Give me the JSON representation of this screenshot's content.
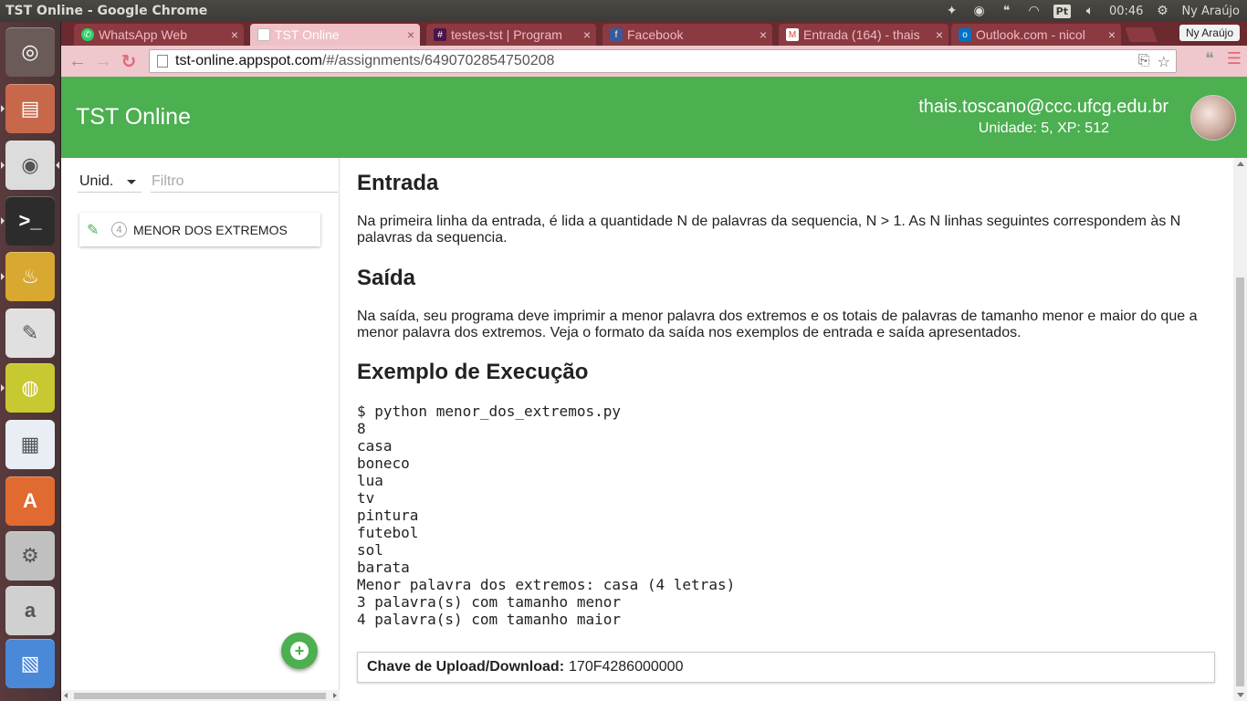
{
  "system": {
    "window_title": "TST Online - Google Chrome",
    "keyboard_layout": "Pt",
    "clock": "00:46",
    "user_name": "Ny Araújo"
  },
  "launcher": {
    "items": [
      {
        "name": "ubuntu-dash",
        "icon": "ubuntu-logo-icon",
        "color": "#6a5a58"
      },
      {
        "name": "files",
        "icon": "files-icon",
        "color": "#c8684a"
      },
      {
        "name": "chrome",
        "icon": "chrome-icon",
        "color": "#dcdcdc"
      },
      {
        "name": "terminal",
        "icon": "terminal-icon",
        "color": "#2c2c2c"
      },
      {
        "name": "genie",
        "icon": "genie-lamp-icon",
        "color": "#d8a830"
      },
      {
        "name": "text-editor",
        "icon": "text-editor-icon",
        "color": "#e0e0e0"
      },
      {
        "name": "speaker",
        "icon": "speaker-icon",
        "color": "#c8c830"
      },
      {
        "name": "libreoffice-impress",
        "icon": "impress-icon",
        "color": "#e8eef4"
      },
      {
        "name": "software-center",
        "icon": "software-center-icon",
        "color": "#e06a30"
      },
      {
        "name": "system-settings",
        "icon": "settings-icon",
        "color": "#c0c0c0"
      },
      {
        "name": "amazon",
        "icon": "amazon-icon",
        "color": "#d0d0d0"
      },
      {
        "name": "workspaces",
        "icon": "workspaces-icon",
        "color": "#4a88d8"
      }
    ]
  },
  "browser": {
    "profile_label": "Ny Araújo",
    "tabs": [
      {
        "label": "WhatsApp Web",
        "color": "#25d366",
        "active": false
      },
      {
        "label": "TST Online",
        "color": "#ffffff",
        "active": true
      },
      {
        "label": "testes-tst | Program",
        "color": "#4a154b",
        "active": false
      },
      {
        "label": "Facebook",
        "color": "#3b5998",
        "active": false
      },
      {
        "label": "Entrada (164) - thais",
        "color": "#d44638",
        "active": false
      },
      {
        "label": "Outlook.com - nicol",
        "color": "#0072c6",
        "active": false
      }
    ],
    "url_host": "tst-online.appspot.com",
    "url_path": "/#/assignments/6490702854750208"
  },
  "app": {
    "brand": "TST Online",
    "user_email": "thais.toscano@ccc.ufcg.edu.br",
    "user_level": "Unidade: 5, XP: 512",
    "accent_color": "#4caf50",
    "sidebar": {
      "unit_select": "Unid.",
      "filter_placeholder": "Filtro",
      "assignments": [
        {
          "number": "4",
          "title": "MENOR DOS EXTREMOS"
        }
      ]
    },
    "content": {
      "input_heading": "Entrada",
      "input_text": "Na primeira linha da entrada, é lida a quantidade N de palavras da sequencia, N > 1. As N linhas seguintes correspondem às N palavras da sequencia.",
      "output_heading": "Saída",
      "output_text": "Na saída, seu programa deve imprimir a menor palavra dos extremos e os totais de palavras de tamanho menor e maior do que a menor palavra dos extremos. Veja o formato da saída nos exemplos de entrada e saída apresentados.",
      "example_heading": "Exemplo de Execução",
      "example_code": "$ python menor_dos_extremos.py\n8\ncasa\nboneco\nlua\ntv\npintura\nfutebol\nsol\nbarata\nMenor palavra dos extremos: casa (4 letras)\n3 palavra(s) com tamanho menor\n4 palavra(s) com tamanho maior",
      "key_label": "Chave de Upload/Download:",
      "key_value": "170F4286000000"
    }
  }
}
